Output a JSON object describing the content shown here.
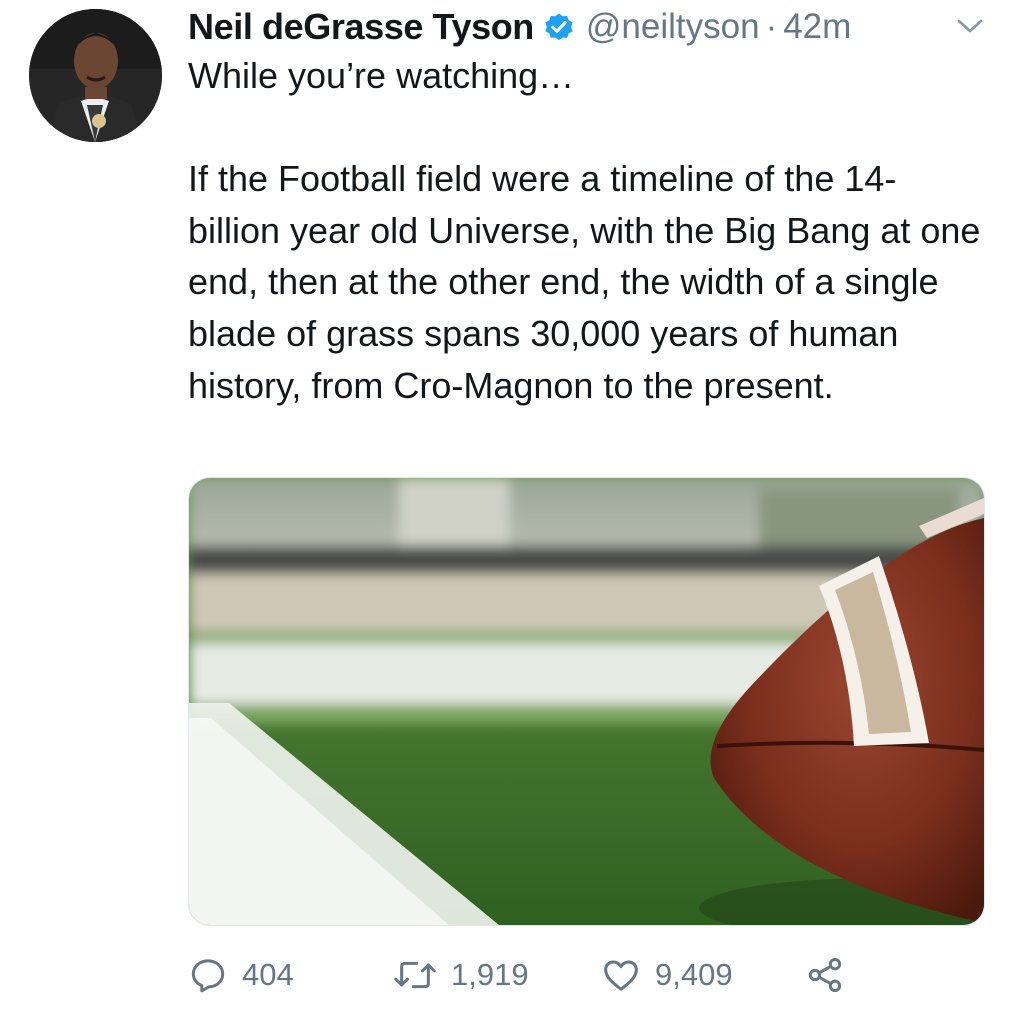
{
  "tweet": {
    "author_name": "Neil deGrasse Tyson",
    "handle": "@neiltyson",
    "separator": "·",
    "time": "42m",
    "verified": true,
    "lines": [
      "While you’re watching…",
      "If the Football field were a timeline of the 14-billion year old Universe, with the Big Bang at one end, then at the other end, the width of a single blade of grass spans 30,000 years of human history, from Cro-Magnon to the present."
    ]
  },
  "actions": {
    "replies": "404",
    "retweets": "1,919",
    "likes": "9,409"
  },
  "icons": {
    "verified": "verified-badge-icon",
    "menu": "chevron-down-icon",
    "reply": "reply-icon",
    "retweet": "retweet-icon",
    "like": "heart-icon",
    "share": "share-icon"
  },
  "colors": {
    "text": "#14171a",
    "secondary": "#657786",
    "verified_blue": "#1da1f2"
  }
}
